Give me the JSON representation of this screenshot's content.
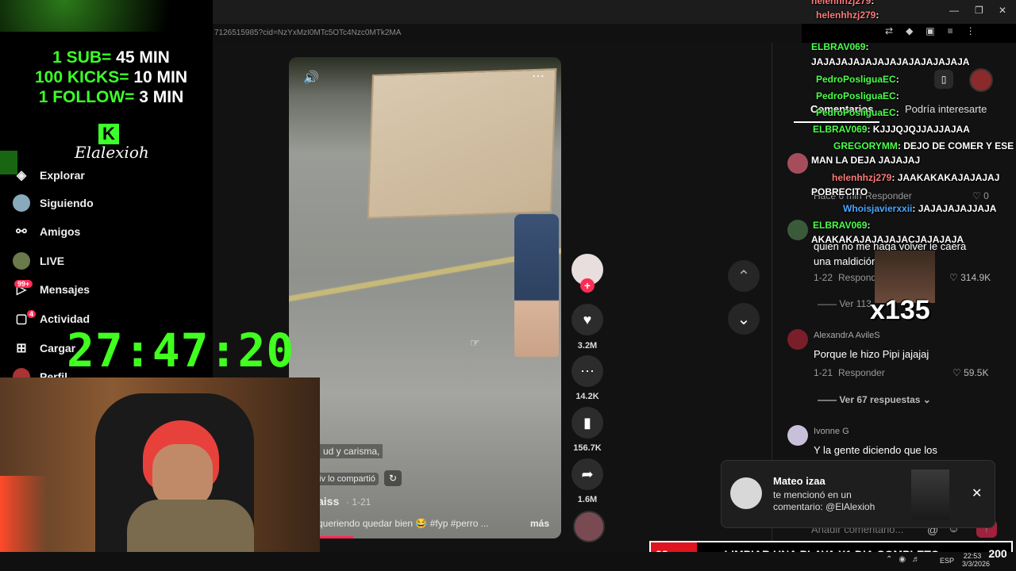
{
  "browser": {
    "url": "71265159​85?cid=NzYxMzI0MTc5OTc4Nzc0MTk2MA"
  },
  "overlay": {
    "rates": [
      "1 SUB=",
      "100 KICKS=",
      "1 FOLLOW="
    ],
    "rate_values": [
      "45 MIN",
      "10 MIN",
      "3 MIN"
    ],
    "logo_text": "Elalexioh",
    "timer": "27:47:20"
  },
  "sidebar": {
    "items": [
      {
        "label": "Explorar",
        "icon": "compass-icon"
      },
      {
        "label": "Siguiendo",
        "icon": "avatar-icon"
      },
      {
        "label": "Amigos",
        "icon": "friends-icon"
      },
      {
        "label": "LIVE",
        "icon": "live-icon"
      },
      {
        "label": "Mensajes",
        "icon": "message-icon",
        "badge": "99+"
      },
      {
        "label": "Actividad",
        "icon": "activity-icon",
        "badge": "4"
      },
      {
        "label": "Cargar",
        "icon": "upload-icon"
      },
      {
        "label": "Perfil",
        "icon": "profile-icon"
      }
    ]
  },
  "video": {
    "caption_partial": "ud y carisma,",
    "shared_label": "iv lo compartió",
    "author": "aiss",
    "date": "· 1-21",
    "description": "queriendo quedar bien 😂 #fyp #perro ...",
    "more": "más"
  },
  "actions": {
    "likes": "3.2M",
    "comments": "14.2K",
    "saves": "156.7K",
    "shares": "1.6M"
  },
  "comments_panel": {
    "tab_comments": "Comentarios",
    "tab_interest": "Podría interesarte",
    "items": [
      {
        "time": "Hace 6 min",
        "reply": "Responder",
        "likes": "0"
      },
      {
        "text": "quien no me haga volver le caerá una maldición de",
        "date": "1-22",
        "reply": "Responder",
        "likes": "314.9K",
        "replies": "Ver 113"
      },
      {
        "name": "AlexandrA AvileS",
        "text": "Porque le hizo Pipi jajajaj",
        "date": "1-21",
        "reply": "Responder",
        "likes": "59.5K",
        "replies": "Ver 67 respuestas"
      },
      {
        "name": "Ivonne G",
        "text": "Y la gente diciendo que los"
      }
    ],
    "add_comment_placeholder": "Añadir comentario..."
  },
  "chat": [
    {
      "user": "helenhhzj279",
      "msg": ":"
    },
    {
      "user": "helenhhzj279",
      "msg": ":"
    },
    {
      "user": "ELBRAV069",
      "msg": ":"
    },
    {
      "user": "",
      "msg": "JAJAJAJAJAJAJAJAJAJAJAJAJA"
    },
    {
      "user": "PedroPosliguaEC",
      "msg": ":"
    },
    {
      "user": "PedroPosliguaEC",
      "msg": ":"
    },
    {
      "user": "PedroPosliguaEC",
      "msg": ":"
    },
    {
      "user": "ELBRAV069",
      "msg": ": KJJJQJQJJAJJAJAA"
    },
    {
      "user": "GREGORYMM",
      "msg": ": DEJO DE COMER Y ESE"
    },
    {
      "user": "",
      "msg": "MAN LA DEJA JAJAJAJ"
    },
    {
      "user": "helenhhzj279",
      "msg": ": JAAKAKAKAJAJAJAJ"
    },
    {
      "user": "",
      "msg": "POBRECITO"
    },
    {
      "user": "Whoisjavierxxii",
      "msg": ": JAJAJAJAJJAJA"
    },
    {
      "user": "ELBRAV069",
      "msg": ":"
    },
    {
      "user": "",
      "msg": "AKAKAKAJAJAJAJACJAJAJAJA"
    }
  ],
  "emote_count": "x135",
  "notification": {
    "name": "Mateo izaa",
    "line1": "te mencionó en un",
    "line2": "comentario: @ElAlexioh"
  },
  "goal": {
    "left": "28",
    "text": "LIMPIAR UNA PLAYA X1 DIA COMPLETO",
    "right": "200"
  },
  "taskbar": {
    "lang": "ESP",
    "time": "22:53",
    "date": "3/3/2026"
  }
}
